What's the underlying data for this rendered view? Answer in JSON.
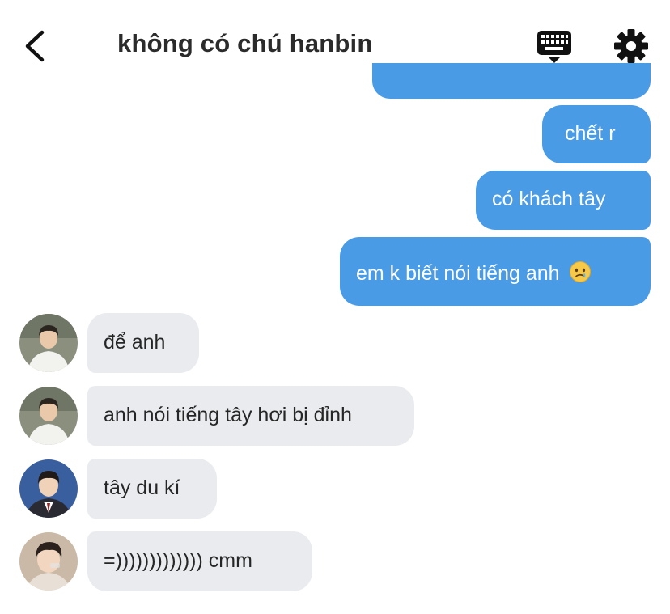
{
  "header": {
    "title": "không có chú hanbin",
    "back_icon": "chevron-left-icon",
    "keyboard_icon": "keyboard-icon",
    "settings_icon": "gear-icon"
  },
  "messages": [
    {
      "sender": "me",
      "text": "chết r"
    },
    {
      "sender": "me",
      "text": "có khách tây"
    },
    {
      "sender": "me",
      "text": "em k biết nói tiếng anh",
      "emoji": "crying-face-icon"
    },
    {
      "sender": "other",
      "text": "để anh"
    },
    {
      "sender": "other",
      "text": "anh nói tiếng tây hơi bị đỉnh"
    },
    {
      "sender": "other",
      "text": "tây du kí"
    },
    {
      "sender": "other",
      "text": "=))))))))))))) cmm"
    }
  ],
  "colors": {
    "outgoing_bubble": "#4a9be6",
    "incoming_bubble": "#e9ebef",
    "title_text": "#2b2b2b"
  }
}
